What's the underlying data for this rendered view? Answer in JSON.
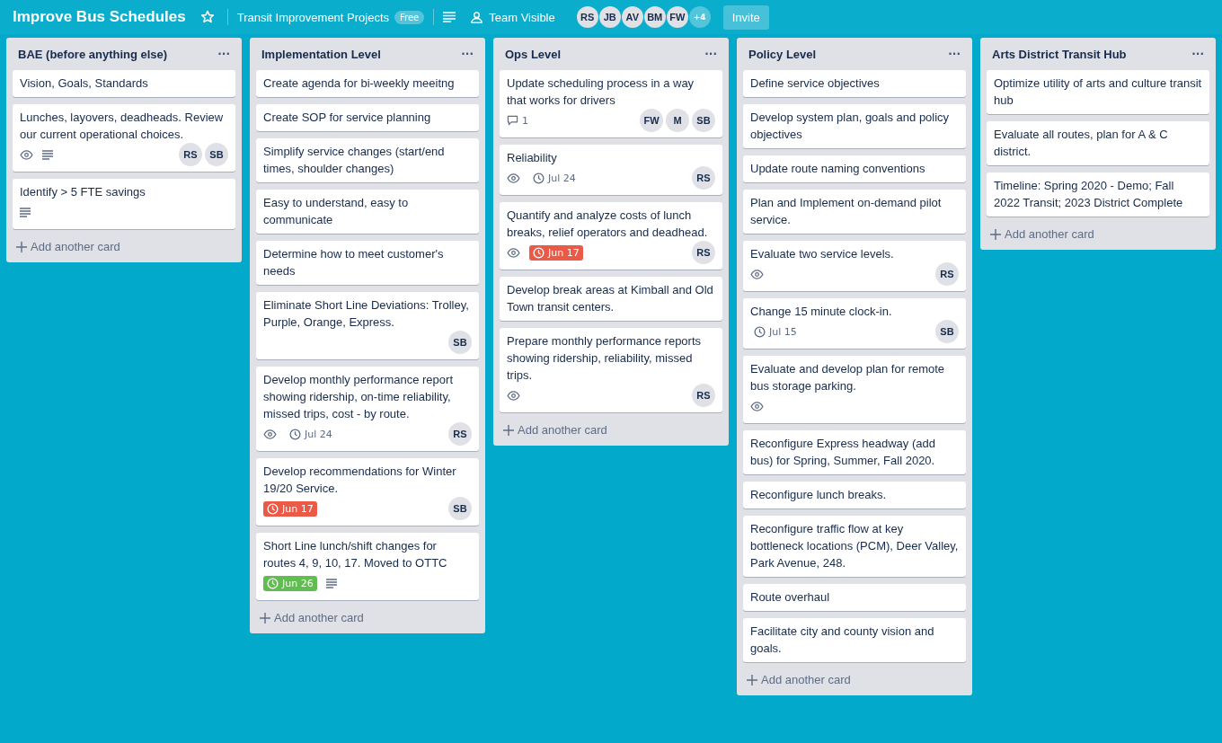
{
  "header": {
    "title": "Improve Bus Schedules",
    "team": "Transit Improvement Projects",
    "plan": "Free",
    "visibility": "Team Visible",
    "members": [
      "RS",
      "JB",
      "AV",
      "BM",
      "FW"
    ],
    "more_members": "+4",
    "invite": "Invite"
  },
  "lists": [
    {
      "title": "BAE (before anything else)",
      "menu": "···",
      "add": "Add another card",
      "cards": [
        {
          "text": "Vision, Goals, Standards"
        },
        {
          "text": "Lunches, layovers, deadheads. Review our current operational choices.",
          "badges": [
            {
              "kind": "watch"
            },
            {
              "kind": "description"
            }
          ],
          "members": [
            "RS",
            "SB"
          ]
        },
        {
          "text": "Identify > 5 FTE savings",
          "badges": [
            {
              "kind": "description"
            }
          ]
        }
      ]
    },
    {
      "title": "Implementation Level",
      "menu": "···",
      "add": "Add another card",
      "cards": [
        {
          "text": "Create agenda for bi-weekly meeitng"
        },
        {
          "text": "Create SOP for service planning"
        },
        {
          "text": "Simplify service changes (start/end times, shoulder changes)"
        },
        {
          "text": "Easy to understand, easy to communicate"
        },
        {
          "text": "Determine how to meet customer's needs"
        },
        {
          "text": "Eliminate Short Line Deviations: Trolley, Purple, Orange, Express.",
          "members": [
            "SB"
          ]
        },
        {
          "text": "Develop monthly performance report showing ridership, on-time reliability, missed trips, cost - by route.",
          "badges": [
            {
              "kind": "watch"
            },
            {
              "kind": "due",
              "text": "Jul 24",
              "overdue": false,
              "complete": false
            }
          ],
          "members": [
            "RS"
          ]
        },
        {
          "text": "Develop recommendations for Winter 19/20 Service.",
          "badges": [
            {
              "kind": "due",
              "text": "Jun 17",
              "overdue": true,
              "complete": false
            }
          ],
          "members": [
            "SB"
          ]
        },
        {
          "text": "Short Line lunch/shift changes for routes 4, 9, 10, 17. Moved to OTTC",
          "badges": [
            {
              "kind": "due",
              "text": "Jun 26",
              "overdue": false,
              "complete": true
            },
            {
              "kind": "description"
            }
          ]
        }
      ]
    },
    {
      "title": "Ops Level",
      "menu": "···",
      "add": "Add another card",
      "cards": [
        {
          "text": "Update scheduling process in a way that works for drivers",
          "badges": [
            {
              "kind": "comments",
              "text": "1"
            }
          ],
          "members": [
            "FW",
            "M",
            "SB"
          ]
        },
        {
          "text": "Reliability",
          "badges": [
            {
              "kind": "watch"
            },
            {
              "kind": "due",
              "text": "Jul 24",
              "overdue": false,
              "complete": false
            }
          ],
          "members": [
            "RS"
          ]
        },
        {
          "text": "Quantify and analyze costs of lunch breaks, relief operators and deadhead.",
          "badges": [
            {
              "kind": "watch"
            },
            {
              "kind": "due",
              "text": "Jun 17",
              "overdue": true,
              "complete": false
            }
          ],
          "members": [
            "RS"
          ]
        },
        {
          "text": "Develop break areas at Kimball and Old Town transit centers."
        },
        {
          "text": "Prepare monthly performance reports showing ridership, reliability, missed trips.",
          "badges": [
            {
              "kind": "watch"
            }
          ],
          "members": [
            "RS"
          ]
        }
      ]
    },
    {
      "title": "Policy Level",
      "menu": "···",
      "add": "Add another card",
      "cards": [
        {
          "text": "Define service objectives"
        },
        {
          "text": "Develop system plan, goals and policy objectives"
        },
        {
          "text": "Update route naming conventions"
        },
        {
          "text": "Plan and Implement on-demand pilot service."
        },
        {
          "text": "Evaluate two service levels.",
          "badges": [
            {
              "kind": "watch"
            }
          ],
          "members": [
            "RS"
          ]
        },
        {
          "text": "Change 15 minute clock-in.",
          "badges": [
            {
              "kind": "due",
              "text": "Jul 15",
              "overdue": false,
              "complete": false
            }
          ],
          "members": [
            "SB"
          ]
        },
        {
          "text": "Evaluate and develop plan for remote bus storage parking.",
          "badges": [
            {
              "kind": "watch"
            }
          ]
        },
        {
          "text": "Reconfigure Express headway (add bus) for Spring, Summer, Fall 2020."
        },
        {
          "text": "Reconfigure lunch breaks."
        },
        {
          "text": "Reconfigure traffic flow at key bottleneck locations (PCM), Deer Valley, Park Avenue, 248."
        },
        {
          "text": "Route overhaul"
        },
        {
          "text": "Facilitate city and county vision and goals."
        }
      ]
    },
    {
      "title": "Arts District Transit Hub",
      "menu": "···",
      "add": "Add another card",
      "cards": [
        {
          "text": "Optimize utility of arts and culture transit hub"
        },
        {
          "text": "Evaluate all routes, plan for A & C district."
        },
        {
          "text": "Timeline: Spring 2020 - Demo; Fall 2022 Transit; 2023 District Complete"
        }
      ]
    }
  ]
}
